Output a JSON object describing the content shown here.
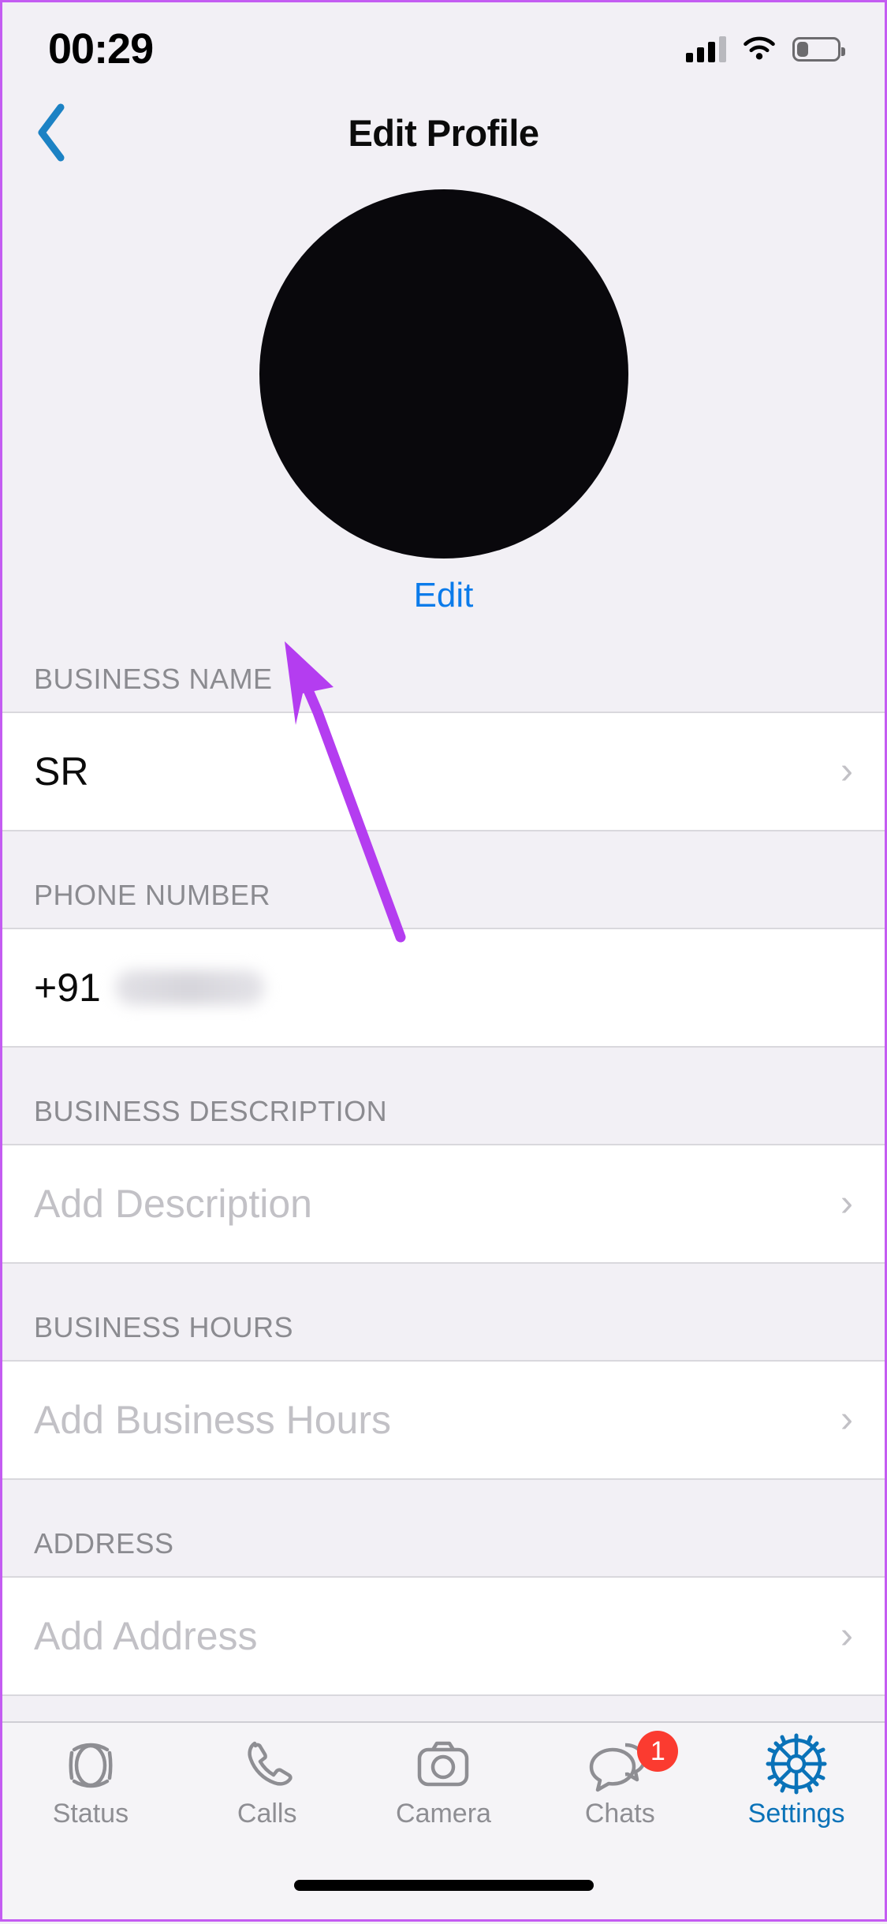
{
  "status_bar": {
    "time": "00:29",
    "signal_icon": "cellular-signal-icon",
    "wifi_icon": "wifi-icon",
    "battery_icon": "battery-low-icon"
  },
  "nav": {
    "back_icon": "chevron-left-icon",
    "title": "Edit Profile"
  },
  "profile": {
    "avatar_name": "profile-photo",
    "edit_label": "Edit"
  },
  "sections": [
    {
      "header": "BUSINESS NAME",
      "value": "SR",
      "is_placeholder": false,
      "has_blurred_value": false,
      "chevron": "›",
      "name": "business-name"
    },
    {
      "header": "PHONE NUMBER",
      "value": "+91",
      "is_placeholder": false,
      "has_blurred_value": true,
      "chevron": "",
      "name": "phone-number"
    },
    {
      "header": "BUSINESS DESCRIPTION",
      "value": "Add Description",
      "is_placeholder": true,
      "has_blurred_value": false,
      "chevron": "›",
      "name": "business-description"
    },
    {
      "header": "BUSINESS HOURS",
      "value": "Add Business Hours",
      "is_placeholder": true,
      "has_blurred_value": false,
      "chevron": "›",
      "name": "business-hours"
    },
    {
      "header": "ADDRESS",
      "value": "Add Address",
      "is_placeholder": true,
      "has_blurred_value": false,
      "chevron": "›",
      "name": "address"
    }
  ],
  "annotation": {
    "type": "arrow",
    "color": "#b43df0",
    "points_to": "Edit"
  },
  "tabbar": {
    "items": [
      {
        "label": "Status",
        "icon": "status-rings-icon",
        "active": false,
        "badge": ""
      },
      {
        "label": "Calls",
        "icon": "phone-handset-icon",
        "active": false,
        "badge": ""
      },
      {
        "label": "Camera",
        "icon": "camera-icon",
        "active": false,
        "badge": ""
      },
      {
        "label": "Chats",
        "icon": "chat-bubbles-icon",
        "active": false,
        "badge": "1"
      },
      {
        "label": "Settings",
        "icon": "gear-icon",
        "active": true,
        "badge": ""
      }
    ]
  },
  "colors": {
    "accent_blue": "#0b7bea",
    "active_tab_blue": "#0a72b8",
    "badge_red": "#fb3b30",
    "annotation_purple": "#b43df0",
    "page_background": "#f2f0f5",
    "row_background": "#ffffff",
    "header_text": "#8b8b90",
    "placeholder_text": "#c2c1c6"
  },
  "home_indicator": "home-indicator-bar"
}
